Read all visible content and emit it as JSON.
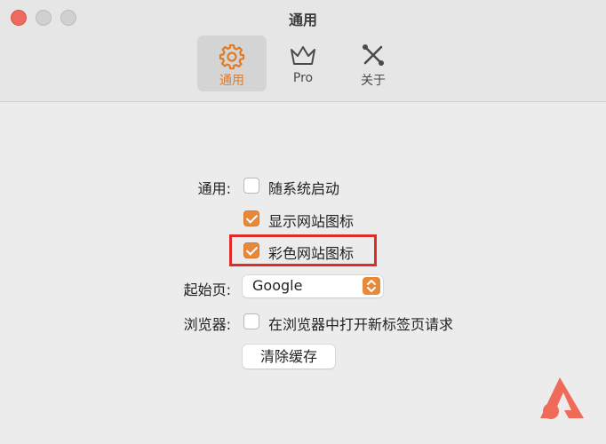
{
  "window": {
    "title": "通用",
    "accent_color": "#e8893a",
    "highlight_color": "#e02b2b"
  },
  "toolbar": {
    "tabs": [
      {
        "label": "通用",
        "icon": "gear-icon",
        "active": true
      },
      {
        "label": "Pro",
        "icon": "crown-icon",
        "active": false
      },
      {
        "label": "关于",
        "icon": "x-tools-icon",
        "active": false
      }
    ]
  },
  "settings": {
    "general_label": "通用:",
    "launch_at_login": {
      "label": "随系统启动",
      "checked": false
    },
    "show_site_icons": {
      "label": "显示网站图标",
      "checked": true
    },
    "colored_site_icons": {
      "label": "彩色网站图标",
      "checked": true
    },
    "homepage_label": "起始页:",
    "homepage_value": "Google",
    "browser_label": "浏览器:",
    "open_new_tab": {
      "label": "在浏览器中打开新标签页请求",
      "checked": false
    },
    "clear_cache_button": "清除缓存"
  },
  "branding": {
    "logo_icon": "app-logo-icon"
  }
}
